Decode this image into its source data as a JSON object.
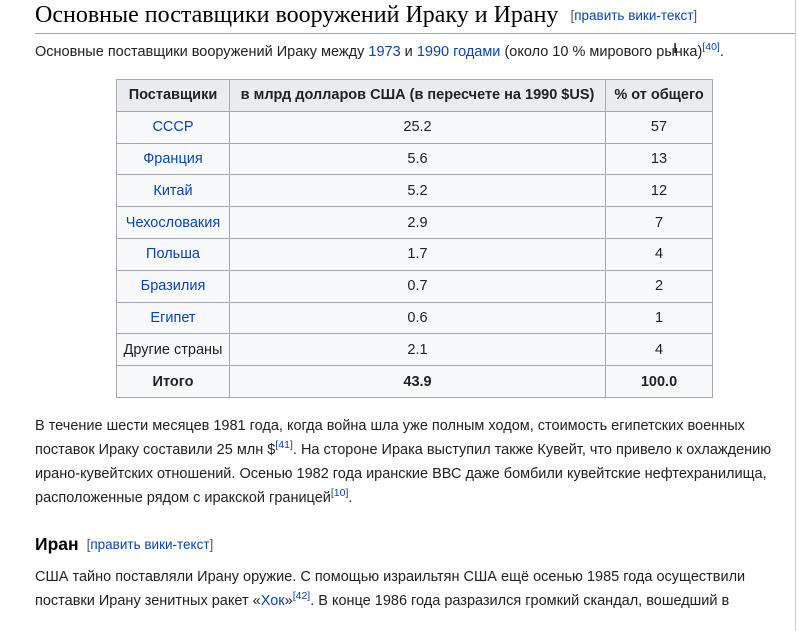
{
  "section": {
    "title": "Основные поставщики вооружений Ираку и Ирану",
    "edit_link": "править вики-текст"
  },
  "intro": {
    "before": "Основные поставщики вооружений Ираку между ",
    "year1": "1973",
    "and": " и ",
    "year2": "1990 годами",
    "after": " (около 10 % мирового рынка)",
    "ref": "[40]",
    "end": "."
  },
  "table": {
    "headers": [
      "Поставщики",
      "в млрд долларов США (в пересчете на 1990 $US)",
      "% от общего"
    ],
    "rows": [
      {
        "supplier": "СССР",
        "amount": "25.2",
        "percent": "57"
      },
      {
        "supplier": "Франция",
        "amount": "5.6",
        "percent": "13"
      },
      {
        "supplier": "Китай",
        "amount": "5.2",
        "percent": "12"
      },
      {
        "supplier": "Чехословакия",
        "amount": "2.9",
        "percent": "7"
      },
      {
        "supplier": "Польша",
        "amount": "1.7",
        "percent": "4"
      },
      {
        "supplier": "Бразилия",
        "amount": "0.7",
        "percent": "2"
      },
      {
        "supplier": "Египет",
        "amount": "0.6",
        "percent": "1"
      },
      {
        "supplier": "Другие страны",
        "amount": "2.1",
        "percent": "4"
      }
    ],
    "total": {
      "label": "Итого",
      "amount": "43.9",
      "percent": "100.0"
    }
  },
  "para1": {
    "a": "В течение шести месяцев 1981 года, когда война шла уже полным ходом, стоимость египетских военных поставок Ираку составили 25 млн $",
    "ref1": "[41]",
    "b": ". На стороне Ирака выступил также Кувейт, что привело к охлаждению ирано-кувейтских отношений. Осенью 1982 года иранские ВВС даже бомбили кувейтские нефтехранилища, расположенные рядом с иракской границей",
    "ref2": "[10]",
    "c": "."
  },
  "subsection": {
    "title": "Иран",
    "edit_link": "править вики-текст"
  },
  "para2": {
    "a": "США тайно поставляли Ирану оружие. С помощью израильтян США ещё осенью 1985 года осуществили поставки Ирану зенитных ракет «",
    "link": "Хок",
    "b": "»",
    "ref": "[42]",
    "c": ". В конце 1986 года разразился громкий скандал, вошедший в"
  }
}
